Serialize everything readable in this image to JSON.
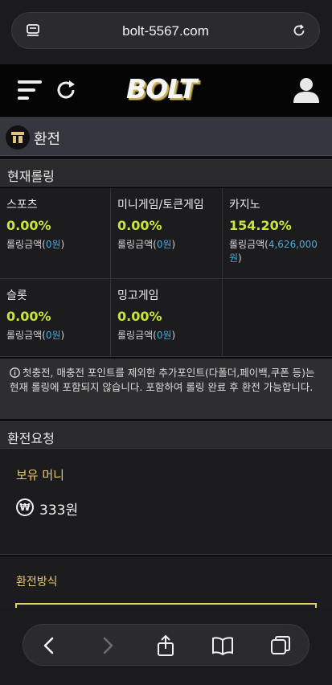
{
  "browser": {
    "url": "bolt-5567.com",
    "reader_icon": "reader-mode-icon",
    "reload_icon": "reload-icon"
  },
  "header": {
    "logo_text": "BOLT",
    "menu_icon": "hamburger-icon",
    "refresh_icon": "refresh-icon",
    "user_icon": "user-icon"
  },
  "page": {
    "title": "환전",
    "title_icon": "exchange-icon"
  },
  "rolling": {
    "heading": "현재롤링",
    "amount_prefix": "롤링금액(",
    "amount_suffix": ")",
    "items": [
      {
        "name": "스포츠",
        "percent": "0.00%",
        "amount": "0원"
      },
      {
        "name": "미니게임/토큰게임",
        "percent": "0.00%",
        "amount": "0원"
      },
      {
        "name": "카지노",
        "percent": "154.20%",
        "amount": "4,626,000원"
      },
      {
        "name": "슬롯",
        "percent": "0.00%",
        "amount": "0원"
      },
      {
        "name": "밍고게임",
        "percent": "0.00%",
        "amount": "0원"
      }
    ],
    "notice": "첫충전, 매충전 포인트를 제외한 추가포인트(다폴더,페이백,쿠폰 등)는 현재 롤링에 포함되지 않습니다. 포함하여 롤링 완료 후 환전 가능합니다.",
    "notice_icon": "info-icon"
  },
  "request": {
    "heading": "환전요청",
    "balance_label": "보유 머니",
    "currency_symbol": "₩",
    "balance_value": "333원",
    "method_label": "환전방식"
  },
  "bottom_nav": {
    "back": "back-icon",
    "forward": "forward-icon",
    "share": "share-icon",
    "bookmarks": "bookmarks-icon",
    "tabs": "tabs-icon"
  }
}
